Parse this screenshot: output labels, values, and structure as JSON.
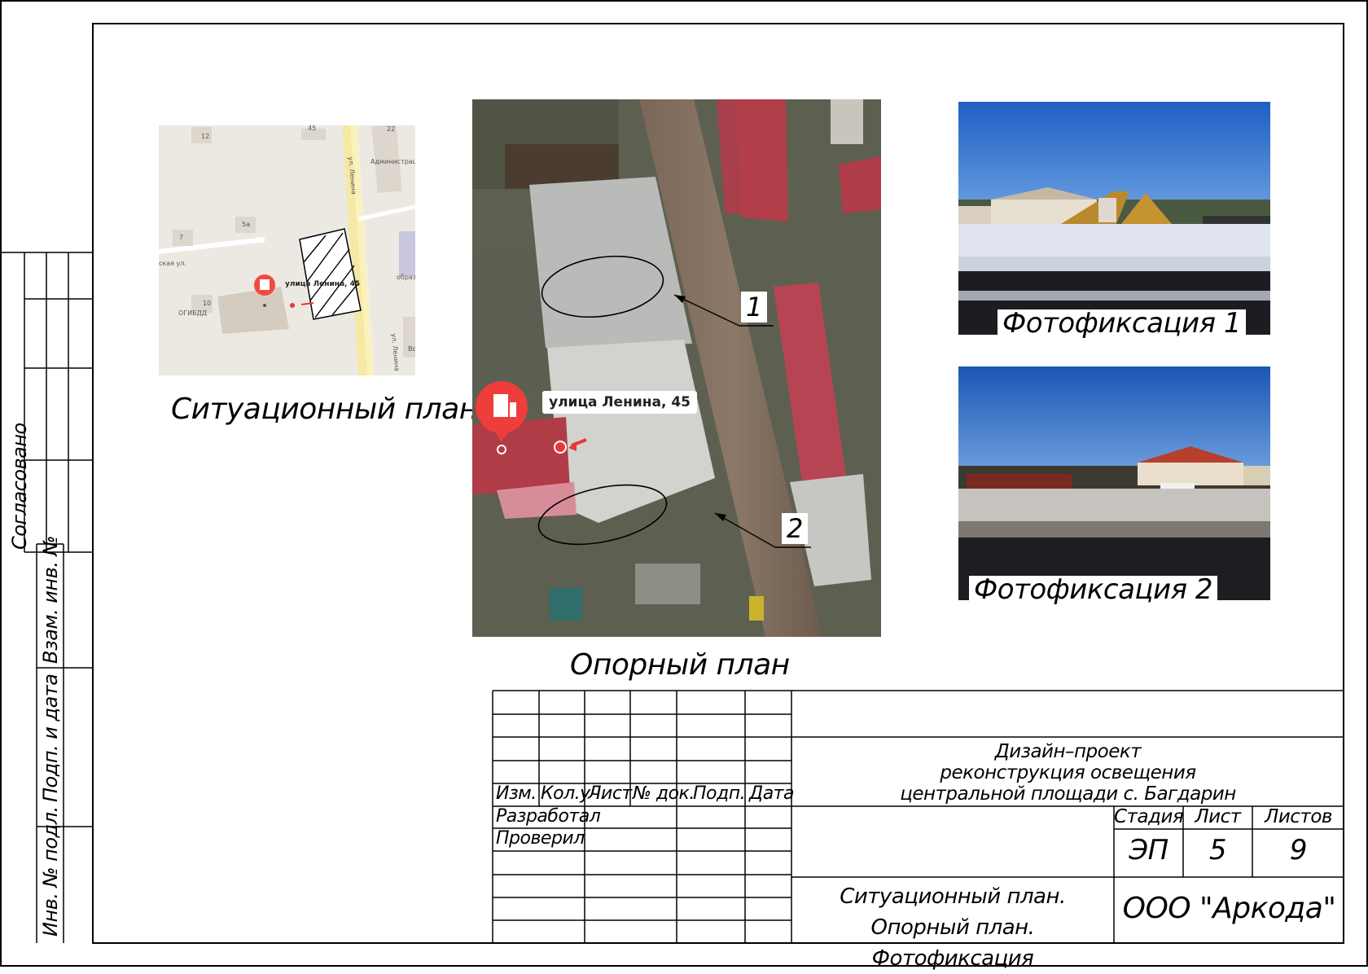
{
  "side_stamp": {
    "agreed": "Согласовано",
    "vzam_inv": "Взам. инв. №",
    "podp_data": "Подп. и дата",
    "inv_podl": "Инв. № подл."
  },
  "situation_plan": {
    "caption": "Ситуационный план",
    "street_label_1": "ул. Ленина",
    "street_label_2": "ул. Ленина",
    "side_street": "ская ул.",
    "address": "улица Ленина, 45",
    "poi_admin": "Администрац",
    "poi_ogibdd": "ОГИБДД",
    "poi_school": "образ",
    "poi_vo": "Во",
    "house_numbers": [
      "12",
      "45",
      "22",
      "5а",
      "7",
      "10"
    ]
  },
  "reference_plan": {
    "caption": "Опорный план",
    "address": "улица Ленина, 45",
    "marker_1": "1",
    "marker_2": "2"
  },
  "photos": [
    {
      "caption": "Фотофиксация 1"
    },
    {
      "caption": "Фотофиксация 2"
    }
  ],
  "title_block": {
    "col_headers": [
      "Изм.",
      "Кол.уч.",
      "Лист",
      "№ док.",
      "Подп.",
      "Дата"
    ],
    "developed": "Разработал",
    "checked": "Проверил",
    "project_title_lines": [
      "Дизайн–проект",
      "реконструкция освещения",
      "центральной площади с. Багдарин"
    ],
    "stage_header": "Стадия",
    "sheet_header": "Лист",
    "sheets_header": "Листов",
    "stage": "ЭП",
    "sheet": "5",
    "sheets": "9",
    "drawing_title_lines": [
      "Ситуационный план. Опорный план.",
      "Фотофиксация"
    ],
    "company": "ООО \"Аркода\""
  }
}
